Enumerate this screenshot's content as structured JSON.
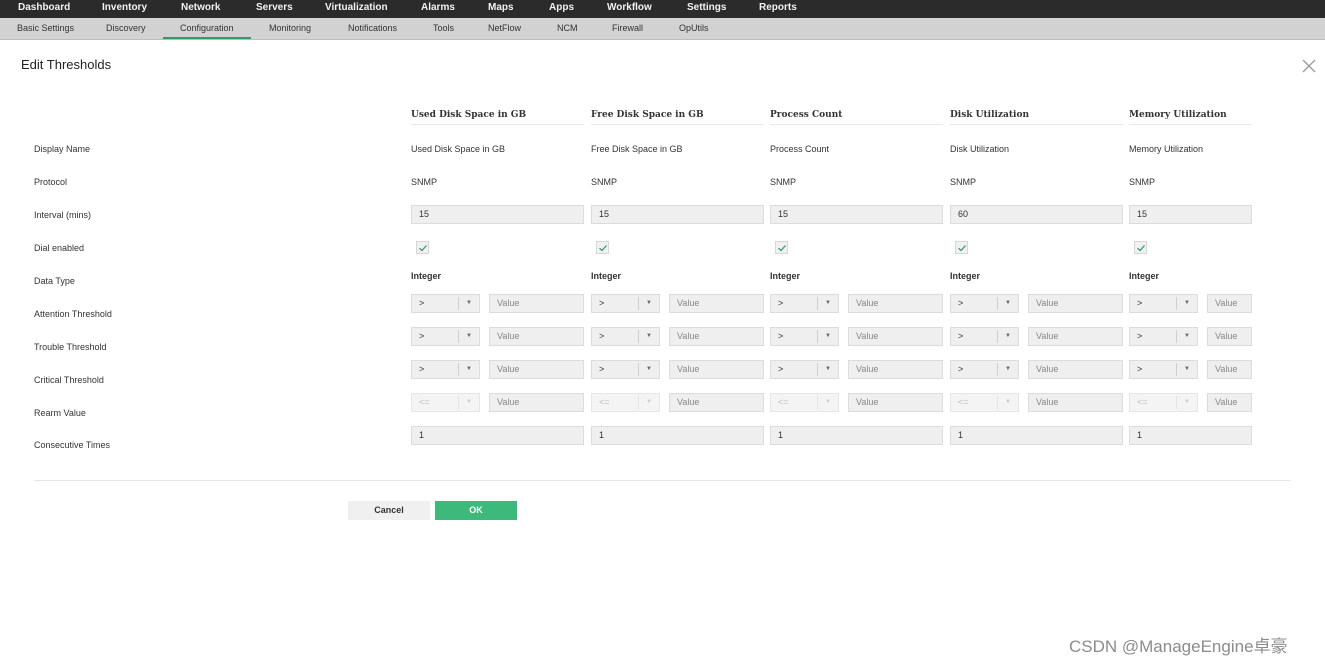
{
  "topnav": [
    "Dashboard",
    "Inventory",
    "Network",
    "Servers",
    "Virtualization",
    "Alarms",
    "Maps",
    "Apps",
    "Workflow",
    "Settings",
    "Reports"
  ],
  "subnav": [
    "Basic Settings",
    "Discovery",
    "Configuration",
    "Monitoring",
    "Notifications",
    "Tools",
    "NetFlow",
    "NCM",
    "Firewall",
    "OpUtils"
  ],
  "subnav_active": "Configuration",
  "page_title": "Edit Thresholds",
  "row_labels": [
    "Display Name",
    "Protocol",
    "Interval (mins)",
    "Dial enabled",
    "Data Type",
    "Attention Threshold",
    "Trouble Threshold",
    "Critical Threshold",
    "Rearm Value",
    "Consecutive Times"
  ],
  "columns": [
    {
      "header": "Used Disk Space in GB",
      "display_name": "Used Disk Space in GB",
      "protocol": "SNMP",
      "interval": "15",
      "dial_enabled": true,
      "data_type": "Integer",
      "attention_op": ">",
      "trouble_op": ">",
      "critical_op": ">",
      "rearm_op": "<=",
      "consecutive": "1"
    },
    {
      "header": "Free Disk Space in GB",
      "display_name": "Free Disk Space in GB",
      "protocol": "SNMP",
      "interval": "15",
      "dial_enabled": true,
      "data_type": "Integer",
      "attention_op": ">",
      "trouble_op": ">",
      "critical_op": ">",
      "rearm_op": "<=",
      "consecutive": "1"
    },
    {
      "header": "Process Count",
      "display_name": "Process Count",
      "protocol": "SNMP",
      "interval": "15",
      "dial_enabled": true,
      "data_type": "Integer",
      "attention_op": ">",
      "trouble_op": ">",
      "critical_op": ">",
      "rearm_op": "<=",
      "consecutive": "1"
    },
    {
      "header": "Disk Utilization",
      "display_name": "Disk Utilization",
      "protocol": "SNMP",
      "interval": "60",
      "dial_enabled": true,
      "data_type": "Integer",
      "attention_op": ">",
      "trouble_op": ">",
      "critical_op": ">",
      "rearm_op": "<=",
      "consecutive": "1"
    },
    {
      "header": "Memory Utilization",
      "display_name": "Memory Utilization",
      "protocol": "SNMP",
      "interval": "15",
      "dial_enabled": true,
      "data_type": "Integer",
      "attention_op": ">",
      "trouble_op": ">",
      "critical_op": ">",
      "rearm_op": "<=",
      "consecutive": "1"
    }
  ],
  "value_placeholder": "Value",
  "buttons": {
    "cancel": "Cancel",
    "ok": "OK"
  },
  "watermark": "CSDN @ManageEngine卓豪",
  "colors": {
    "topnav_bg": "#2b2b2b",
    "subnav_bg": "#d2d2d2",
    "accent": "#3dba7b",
    "check": "#2e9c6a"
  }
}
